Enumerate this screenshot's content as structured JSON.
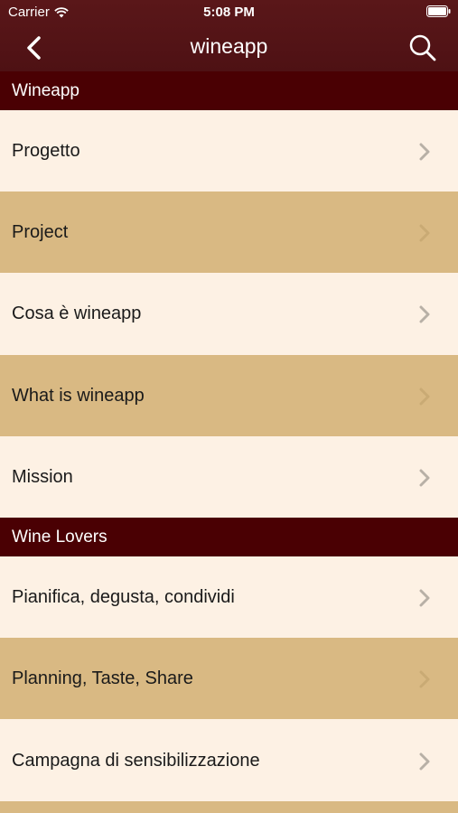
{
  "status_bar": {
    "carrier": "Carrier",
    "time": "5:08 PM"
  },
  "navbar": {
    "title": "wineapp",
    "back_icon": "chevron-left-icon",
    "search_icon": "search-icon"
  },
  "colors": {
    "header_bg": "#4a0003",
    "nav_bg": "#55151a",
    "row_light": "#fdf1e4",
    "row_tan": "#d9b983",
    "chevron": "#b8b0a6"
  },
  "sections": [
    {
      "title": "Wineapp",
      "items": [
        {
          "label": "Progetto"
        },
        {
          "label": "Project"
        },
        {
          "label": "Cosa è wineapp"
        },
        {
          "label": "What is wineapp"
        },
        {
          "label": "Mission"
        }
      ]
    },
    {
      "title": "Wine Lovers",
      "items": [
        {
          "label": "Pianifica, degusta, condividi"
        },
        {
          "label": "Planning, Taste, Share"
        },
        {
          "label": "Campagna di sensibilizzazione"
        }
      ]
    }
  ]
}
